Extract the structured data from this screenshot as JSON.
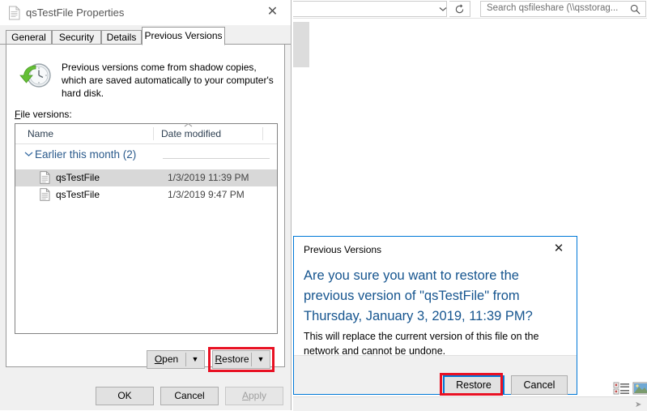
{
  "explorer": {
    "address_placeholder": "",
    "address_chevron_icon": "chevron-down-icon",
    "refresh_icon": "refresh-icon",
    "search_placeholder": "Search qsfileshare (\\\\qsstorag...",
    "search_icon": "search-icon",
    "view_details_icon": "details-view-icon",
    "view_icons_icon": "large-icons-view-icon",
    "resize_grip_icon": "resize-grip-icon"
  },
  "properties": {
    "title": "qsTestFile Properties",
    "title_icon": "file-icon",
    "close_label": "✕",
    "tabs": [
      {
        "label": "General",
        "active": false
      },
      {
        "label": "Security",
        "active": false
      },
      {
        "label": "Details",
        "active": false
      },
      {
        "label": "Previous Versions",
        "active": true
      }
    ],
    "previous_versions": {
      "icon": "clock-restore-icon",
      "description": "Previous versions come from shadow copies, which are saved automatically to your computer's hard disk.",
      "file_versions_label": "File versions:",
      "file_versions_accel": "F",
      "columns": [
        "Name",
        "Date modified"
      ],
      "group": {
        "chevron_icon": "chevron-down-icon",
        "label": "Earlier this month (2)"
      },
      "rows": [
        {
          "icon": "file-icon",
          "name": "qsTestFile",
          "date": "1/3/2019 11:39 PM",
          "selected": true
        },
        {
          "icon": "file-icon",
          "name": "qsTestFile",
          "date": "1/3/2019 9:47 PM",
          "selected": false
        }
      ],
      "open_button": {
        "label": "Open",
        "accel": "O",
        "dropdown_icon": "caret-down-icon"
      },
      "restore_button": {
        "label": "Restore",
        "accel": "R",
        "dropdown_icon": "caret-down-icon"
      }
    },
    "footer_buttons": [
      {
        "label": "OK",
        "disabled": false
      },
      {
        "label": "Cancel",
        "disabled": false
      },
      {
        "label": "Apply",
        "accel": "A",
        "disabled": true
      }
    ]
  },
  "confirm_dialog": {
    "title": "Previous Versions",
    "close_label": "✕",
    "message": "Are you sure you want to restore the previous version of \"qsTestFile\" from Thursday, January 3, 2019, 11:39 PM?",
    "warning": "This will replace the current version of this file on the network and cannot be undone.",
    "restore_label": "Restore",
    "cancel_label": "Cancel"
  },
  "annotations": {
    "highlight_color": "#e81123",
    "focus_color": "#0078d7",
    "boxes": [
      "restore-split-button",
      "dialog-restore-button"
    ]
  }
}
